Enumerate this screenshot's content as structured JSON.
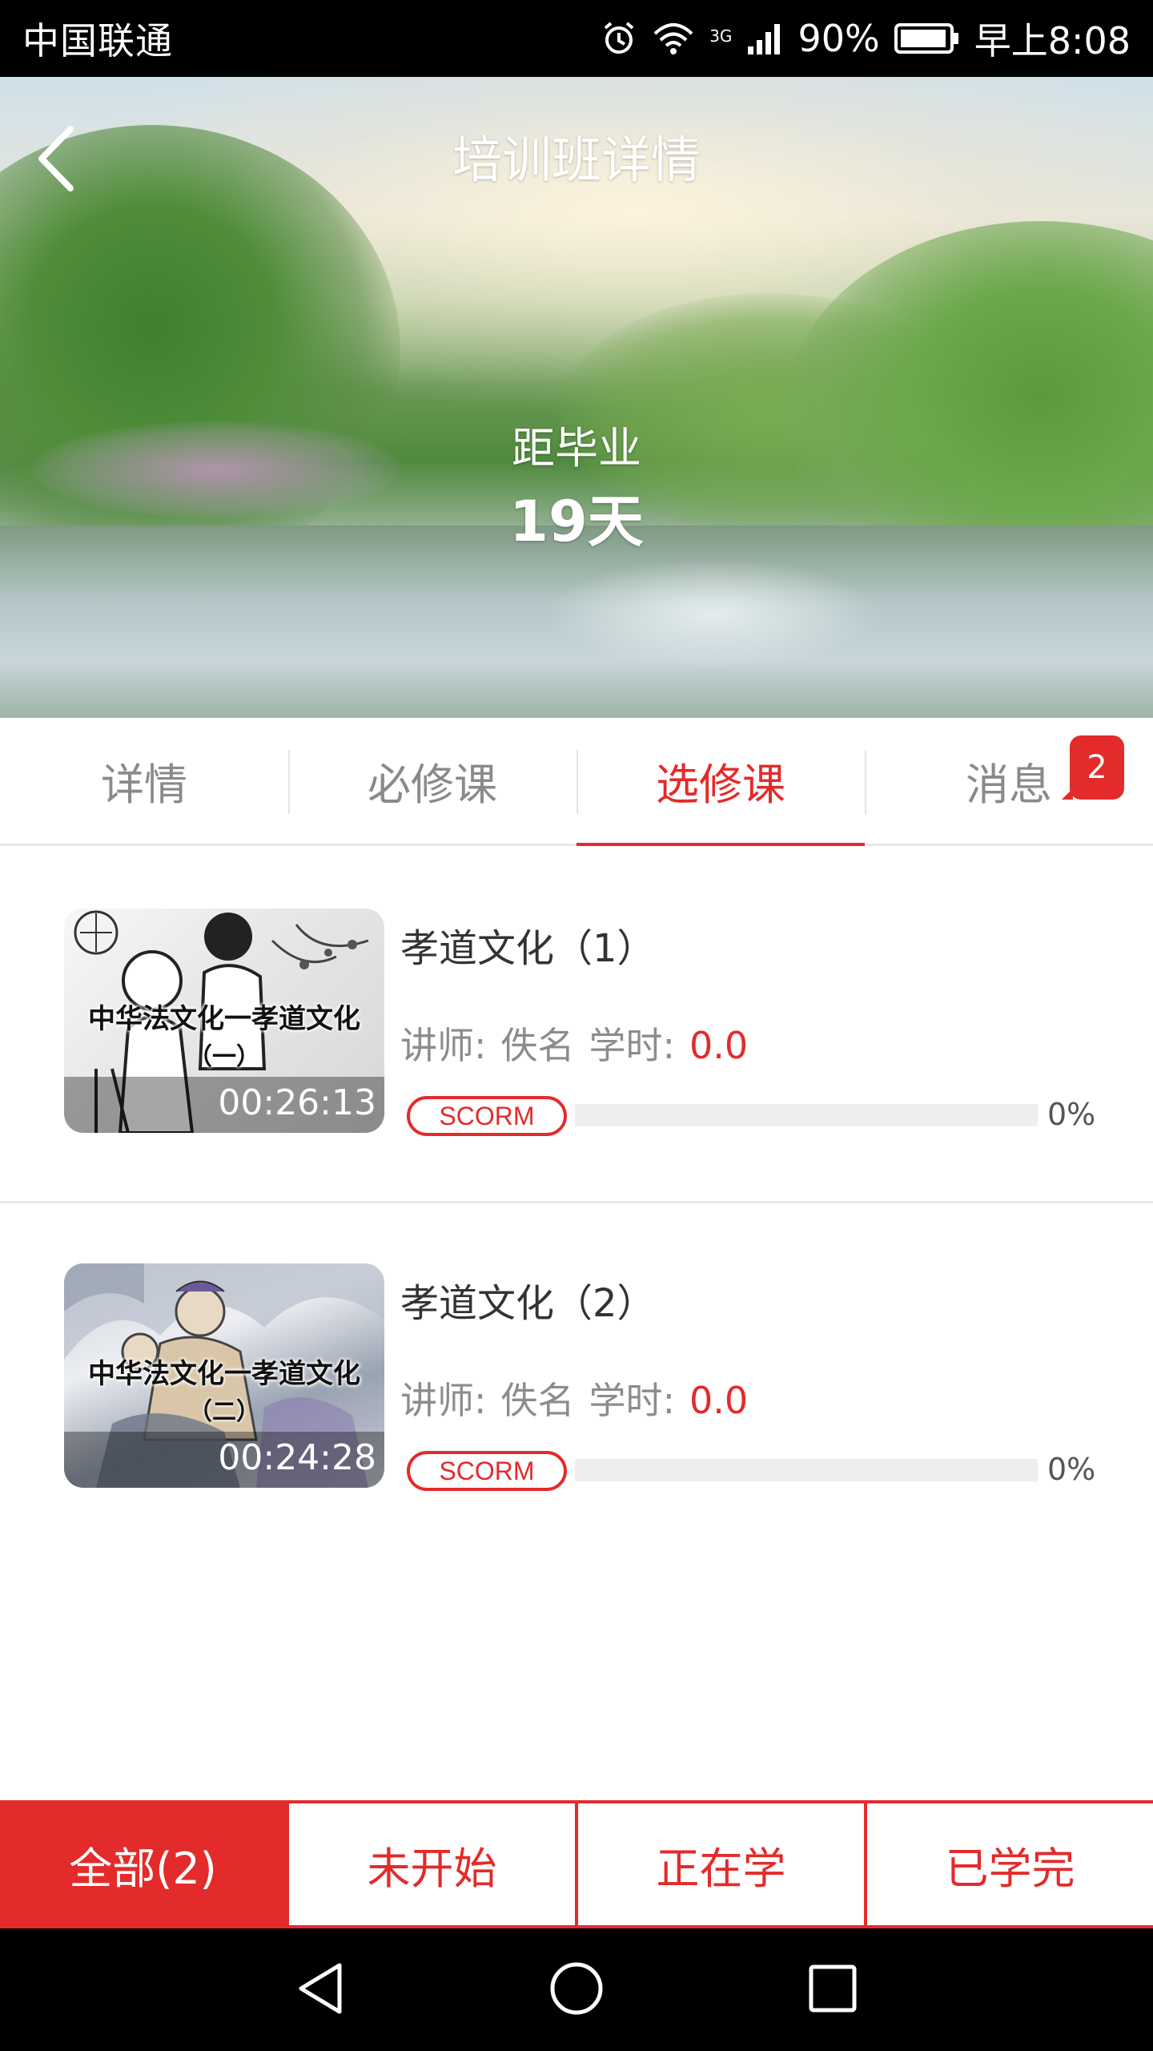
{
  "status_bar": {
    "carrier": "中国联通",
    "network": "3G",
    "battery": "90%",
    "time": "早上8:08",
    "icons": [
      "alarm-icon",
      "wifi-icon",
      "signal-icon",
      "battery-icon"
    ]
  },
  "header": {
    "title": "培训班详情",
    "back_icon": "chevron-left-icon",
    "countdown_label": "距毕业",
    "countdown_value": "19天"
  },
  "tabs": [
    {
      "label": "详情",
      "active": false
    },
    {
      "label": "必修课",
      "active": false
    },
    {
      "label": "选修课",
      "active": true
    },
    {
      "label": "消息",
      "active": false,
      "badge": "2"
    }
  ],
  "courses": [
    {
      "title": "孝道文化（1）",
      "thumb_title": "中华法文化一孝道文化",
      "thumb_sub": "（一）",
      "duration": "00:26:13",
      "lecturer_label": "讲师:",
      "lecturer": "佚名",
      "hours_label": "学时:",
      "hours": "0.0",
      "tag": "SCORM",
      "progress": 0,
      "progress_text": "0%"
    },
    {
      "title": "孝道文化（2）",
      "thumb_title": "中华法文化一孝道文化",
      "thumb_sub": "（二）",
      "duration": "00:24:28",
      "lecturer_label": "讲师:",
      "lecturer": "佚名",
      "hours_label": "学时:",
      "hours": "0.0",
      "tag": "SCORM",
      "progress": 0,
      "progress_text": "0%"
    }
  ],
  "filters": [
    {
      "label": "全部(2)",
      "active": true
    },
    {
      "label": "未开始",
      "active": false
    },
    {
      "label": "正在学",
      "active": false
    },
    {
      "label": "已学完",
      "active": false
    }
  ],
  "nav_bar": {
    "icons": [
      "back-triangle-icon",
      "home-circle-icon",
      "recents-square-icon"
    ]
  },
  "colors": {
    "accent": "#e32b2b",
    "tab_inactive": "#8a8a8a",
    "divider": "#e6e6e6"
  }
}
